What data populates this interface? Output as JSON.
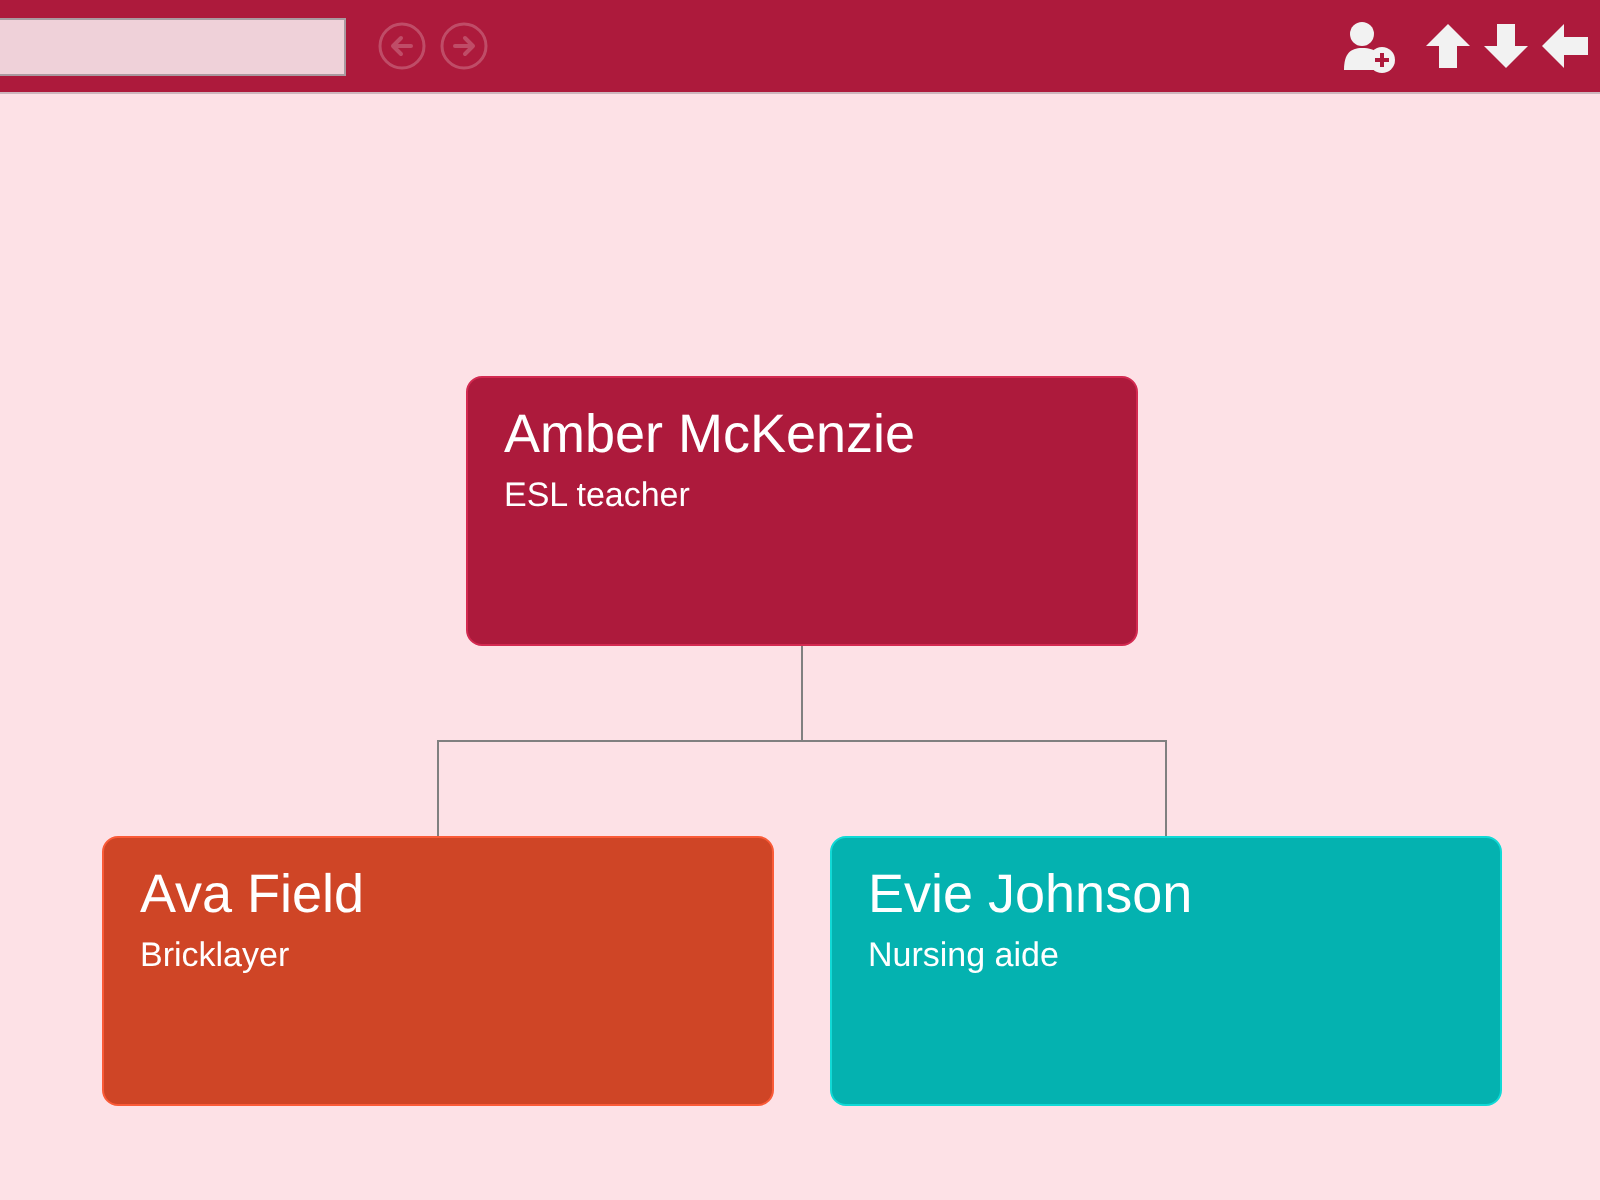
{
  "toolbar": {
    "nav_buttons": [
      {
        "kind": "back",
        "disabled": true
      },
      {
        "kind": "forward",
        "disabled": true
      }
    ],
    "tools": [
      {
        "kind": "add-person"
      },
      {
        "kind": "up"
      },
      {
        "kind": "down"
      },
      {
        "kind": "left"
      }
    ]
  },
  "org_chart": {
    "root": {
      "name": "Amber McKenzie",
      "title": "ESL teacher",
      "color": "#ad1a3c",
      "children": [
        {
          "name": "Ava Field",
          "title": "Bricklayer",
          "color": "#cf4526"
        },
        {
          "name": "Evie Johnson",
          "title": "Nursing aide",
          "color": "#04b2b0"
        }
      ]
    }
  }
}
